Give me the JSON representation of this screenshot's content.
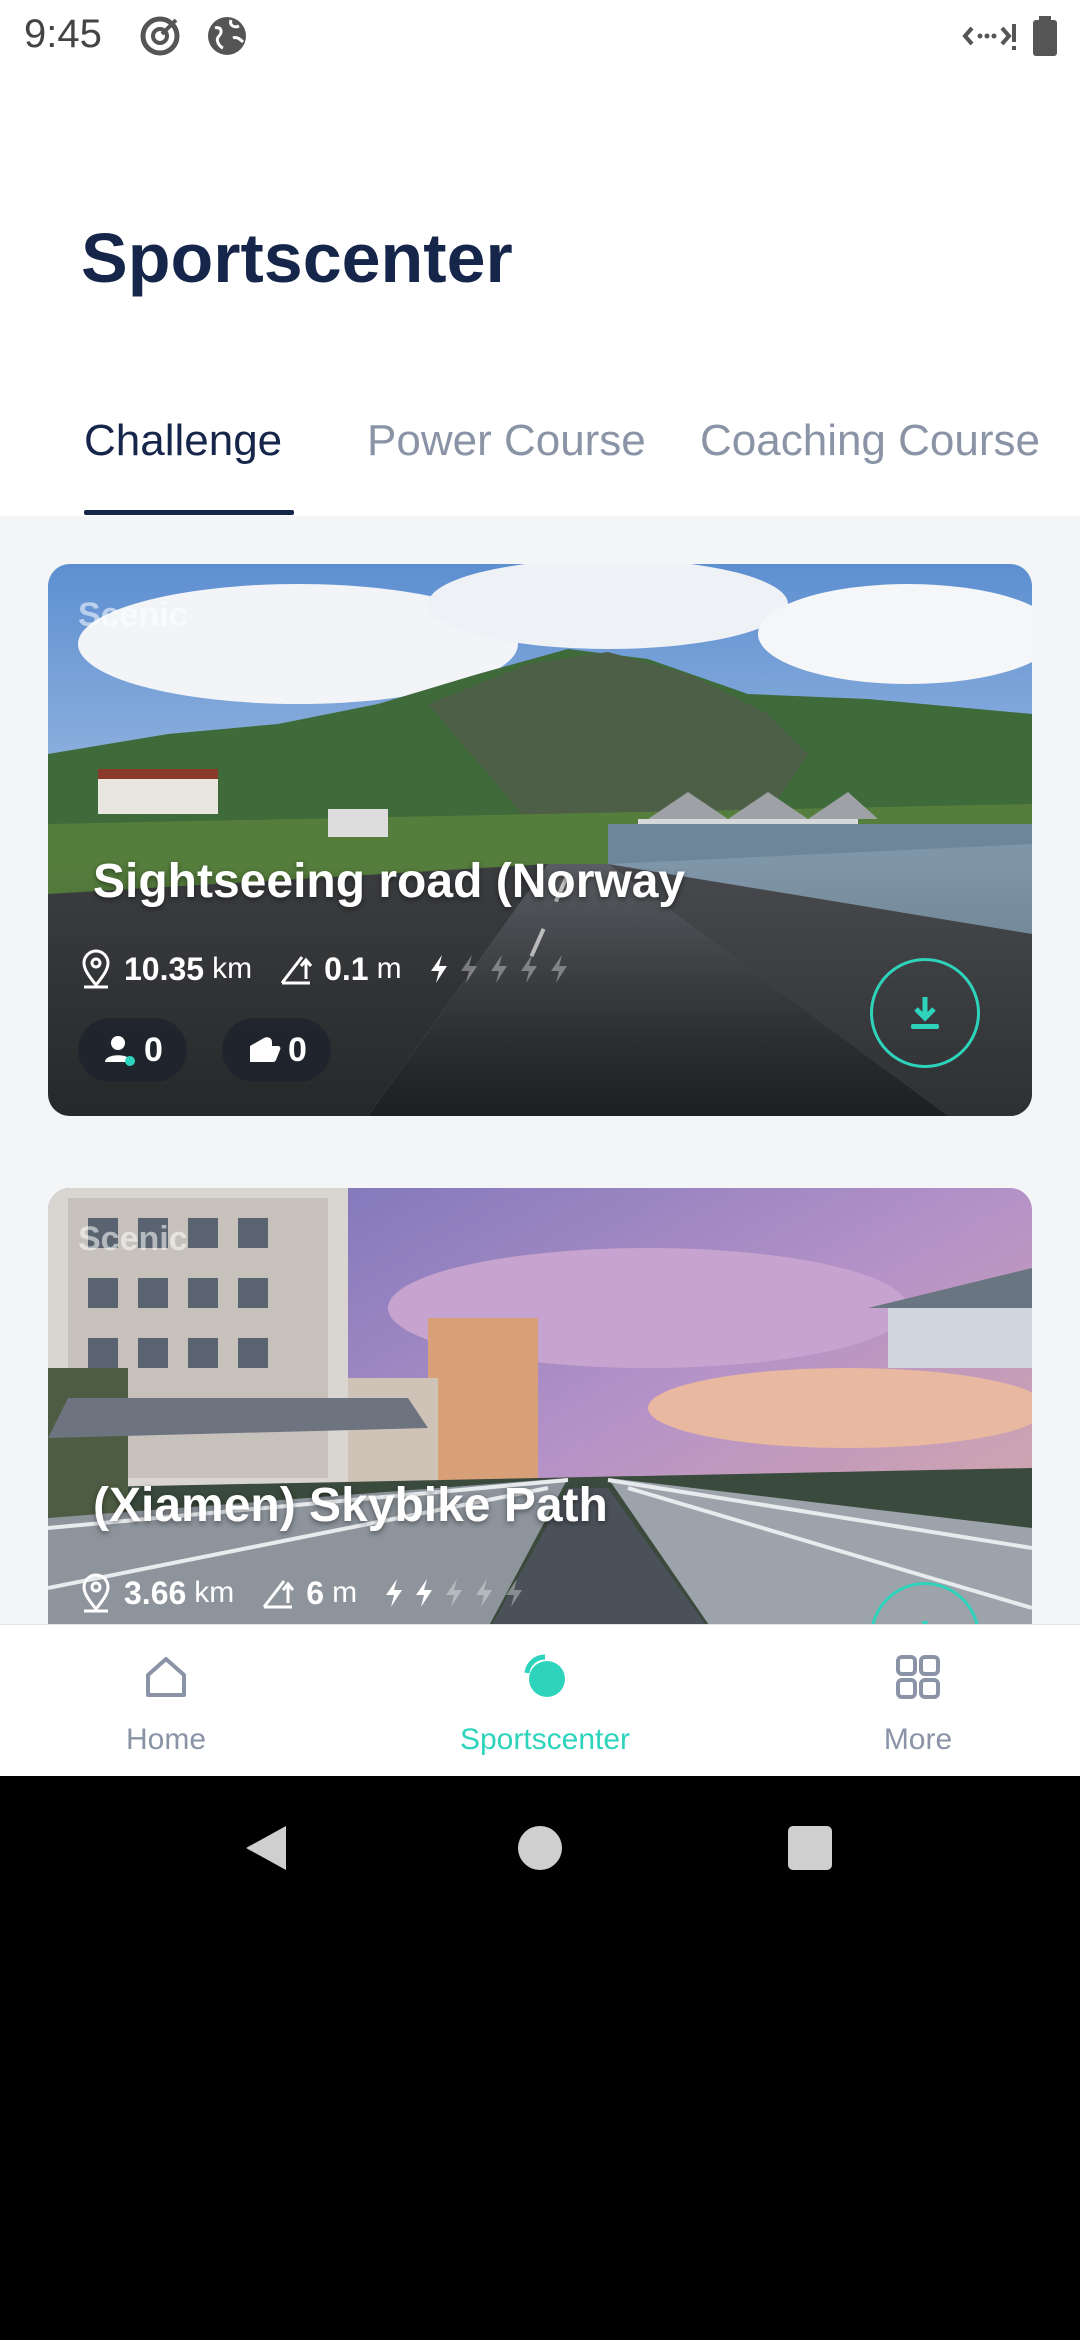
{
  "status_bar": {
    "time": "9:45",
    "icons": [
      "target-icon",
      "globe-icon",
      "data-transfer-icon",
      "battery-icon"
    ]
  },
  "header": {
    "title": "Sportscenter"
  },
  "tabs": [
    {
      "label": "Challenge",
      "active": true
    },
    {
      "label": "Power Course",
      "active": false
    },
    {
      "label": "Coaching Course",
      "active": false
    }
  ],
  "cards": [
    {
      "tag": "Scenic",
      "title": "Sightseeing road (Norway",
      "distance": "10.35",
      "distance_unit": "km",
      "elevation": "0.1",
      "elevation_unit": "m",
      "difficulty": 1,
      "difficulty_max": 5,
      "riders": "0",
      "likes": "0",
      "download_icon": "download-icon"
    },
    {
      "tag": "Scenic",
      "title": "(Xiamen) Skybike Path",
      "distance": "3.66",
      "distance_unit": "km",
      "elevation": "6",
      "elevation_unit": "m",
      "difficulty": 2,
      "difficulty_max": 5,
      "download_icon": "download-icon"
    }
  ],
  "bottom_nav": [
    {
      "label": "Home",
      "icon": "home-icon",
      "active": false
    },
    {
      "label": "Sportscenter",
      "icon": "sportscenter-icon",
      "active": true
    },
    {
      "label": "More",
      "icon": "grid-icon",
      "active": false
    }
  ],
  "colors": {
    "accent": "#2ed3bc",
    "title": "#15264a",
    "muted": "#8a94a6"
  }
}
